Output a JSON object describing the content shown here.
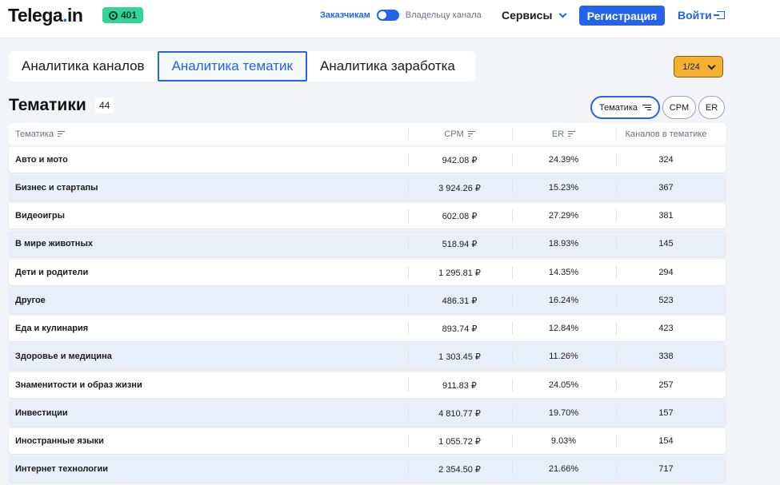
{
  "header": {
    "logo_main": "Telega",
    "logo_dot": ".",
    "logo_tail": "in",
    "badge_count": "401",
    "toggle_left": "Заказчикам",
    "toggle_right": "Владельцу канала",
    "services": "Сервисы",
    "register": "Регистрация",
    "login": "Войти"
  },
  "tabs": [
    {
      "label": "Аналитика каналов",
      "active": false
    },
    {
      "label": "Аналитика тематик",
      "active": true
    },
    {
      "label": "Аналитика заработка",
      "active": false
    }
  ],
  "pager": "1/24",
  "section": {
    "title": "Тематики",
    "count": "44",
    "sort_buttons": [
      "Тематика",
      "CPM",
      "ER"
    ]
  },
  "table": {
    "headers": [
      "Тематика",
      "CPM",
      "ER",
      "Каналов в тематике"
    ],
    "rows": [
      {
        "name": "Авто и мото",
        "cpm": "942.08 ₽",
        "er": "24.39%",
        "channels": "324"
      },
      {
        "name": "Бизнес и стартапы",
        "cpm": "3 924.26 ₽",
        "er": "15.23%",
        "channels": "367"
      },
      {
        "name": "Видеоигры",
        "cpm": "602.08 ₽",
        "er": "27.29%",
        "channels": "381"
      },
      {
        "name": "В мире животных",
        "cpm": "518.94 ₽",
        "er": "18.93%",
        "channels": "145"
      },
      {
        "name": "Дети и родители",
        "cpm": "1 295.81 ₽",
        "er": "14.35%",
        "channels": "294"
      },
      {
        "name": "Другое",
        "cpm": "486.31 ₽",
        "er": "16.24%",
        "channels": "523"
      },
      {
        "name": "Еда и кулинария",
        "cpm": "893.74 ₽",
        "er": "12.84%",
        "channels": "423"
      },
      {
        "name": "Здоровье и медицина",
        "cpm": "1 303.45 ₽",
        "er": "11.26%",
        "channels": "338"
      },
      {
        "name": "Знаменитости и образ жизни",
        "cpm": "911.83 ₽",
        "er": "24.05%",
        "channels": "257"
      },
      {
        "name": "Инвестиции",
        "cpm": "4 810.77 ₽",
        "er": "19.70%",
        "channels": "157"
      },
      {
        "name": "Иностранные языки",
        "cpm": "1 055.72 ₽",
        "er": "9.03%",
        "channels": "154"
      },
      {
        "name": "Интернет технологии",
        "cpm": "2 354.50 ₽",
        "er": "21.66%",
        "channels": "717"
      }
    ]
  },
  "colors": {
    "accent": "#2563eb",
    "badge": "#34d399",
    "pager": "#f5b034",
    "row_alt": "#e9eefb"
  }
}
